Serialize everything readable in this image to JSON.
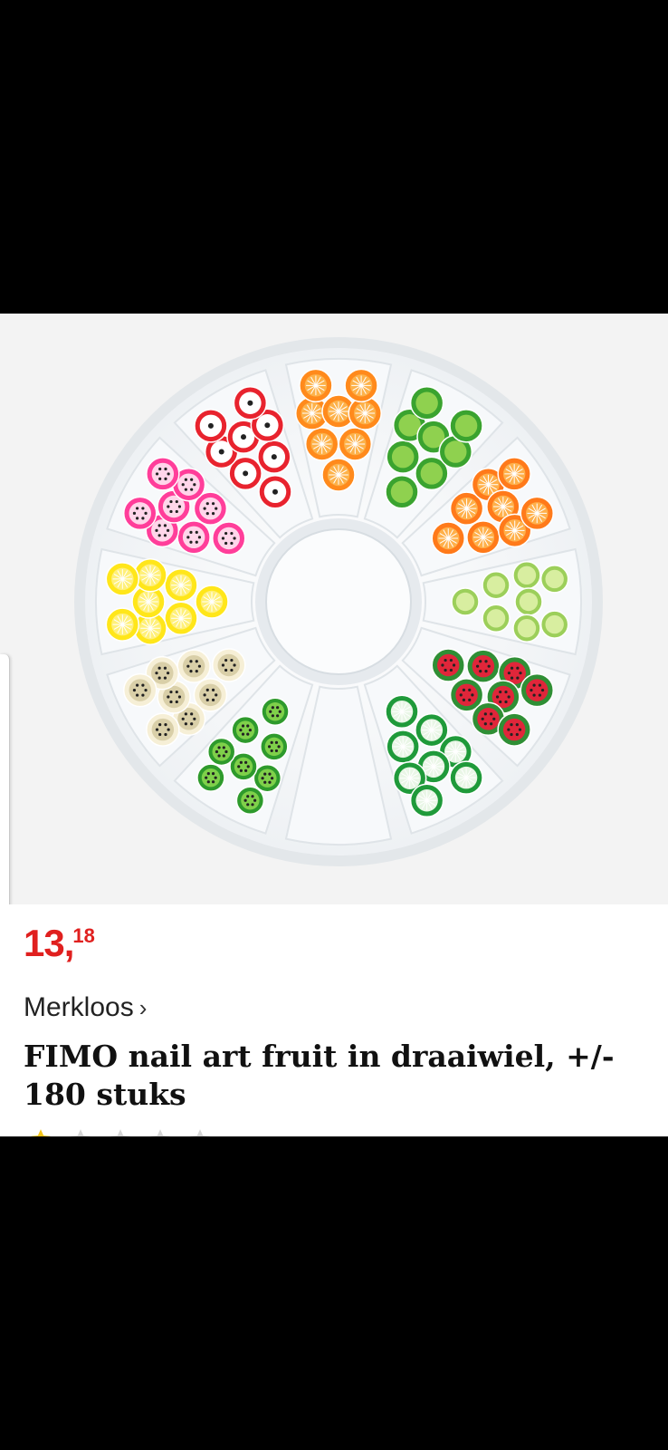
{
  "product": {
    "price_whole": "13",
    "price_comma": ",",
    "price_cents": "18",
    "brand": "Merkloos",
    "brand_chevron": "›",
    "title": "FIMO nail art fruit in draaiwiel, +/- 180 stuks"
  },
  "rating": {
    "stars_total": 5,
    "stars_filled": 1
  },
  "colors": {
    "price": "#e0201f",
    "image_background": "#f3f3f3",
    "star_filled": "#f5c518",
    "star_empty": "#d6d6d6"
  },
  "icons": {
    "brand_chevron": "chevron-right-icon",
    "rating_star": "star-icon"
  }
}
